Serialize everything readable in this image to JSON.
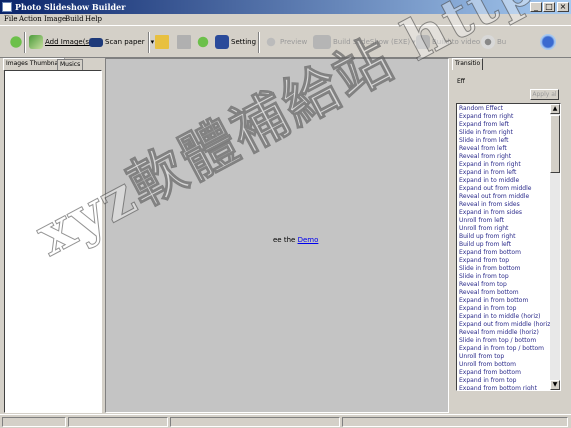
{
  "window": {
    "title": "Photo Slideshow Builder"
  },
  "menu": [
    "File",
    "Action",
    "Image",
    "Build",
    "Help"
  ],
  "toolbar": {
    "add_images": "Add Image(s)",
    "scan_paper": "Scan paper",
    "setting": "Setting",
    "preview": "Preview",
    "build_slideshow": "Build SlideShow (EXE)",
    "build_video": "Build to video",
    "burn": "Bu"
  },
  "left_tabs": [
    "Images Thumbnail",
    "Musics"
  ],
  "preview": {
    "see_text": "ee the",
    "demo_link": "Demo"
  },
  "right": {
    "tab": "Transitio",
    "effect_label": "Eff",
    "apply_button": "Apply al",
    "effects": [
      "Random Effect",
      "Expand from right",
      "Expand from left",
      "Slide in from right",
      "Slide in from left",
      "Reveal from left",
      "Reveal from right",
      "Expand in from right",
      "Expand in from left",
      "Expand in to middle",
      "Expand out from middle",
      "Reveal out from middle",
      "Reveal in from sides",
      "Expand in from sides",
      "Unroll from left",
      "Unroll from right",
      "Build up from right",
      "Build up from left",
      "Expand from bottom",
      "Expand from top",
      "Slide in from bottom",
      "Slide in from top",
      "Reveal from top",
      "Reveal from bottom",
      "Expand in from bottom",
      "Expand in from top",
      "Expand in to middle (horiz)",
      "Expand out from middle (horiz)",
      "Reveal from middle (horiz)",
      "Slide in from top / bottom",
      "Expand in from top / bottom",
      "Unroll from top",
      "Unroll from bottom",
      "Expand from bottom",
      "Expand in from top",
      "Expand from bottom right"
    ]
  },
  "watermark": "xyz軟體補給站 http://3 1 .to",
  "colors": {
    "title_start": "#0a246a",
    "title_end": "#a6caf0",
    "face": "#d4d0c8",
    "list_text": "#2a2a8a",
    "link": "#0000ee"
  }
}
